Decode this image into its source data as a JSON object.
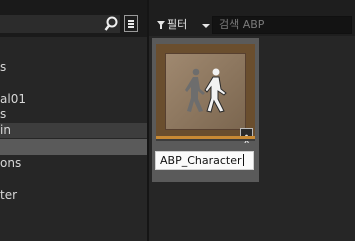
{
  "left_panel": {
    "items": [
      {
        "label": "s",
        "selected": false
      },
      {
        "label": "al01",
        "selected": false
      },
      {
        "label": "s",
        "selected": false
      },
      {
        "label": "in",
        "selected": false
      },
      {
        "label": "",
        "selected": true
      },
      {
        "label": "ons",
        "selected": false
      },
      {
        "label": "ter",
        "selected": false
      }
    ]
  },
  "toolbar": {
    "filter_label": "필터",
    "search_placeholder": "검색 ABP"
  },
  "asset": {
    "name": "ABP_Character",
    "accent_color": "#c98a34"
  },
  "icons": [
    "search-icon",
    "settings-icon",
    "filter-icon",
    "chevron-down-icon",
    "animation-blueprint-icon"
  ]
}
